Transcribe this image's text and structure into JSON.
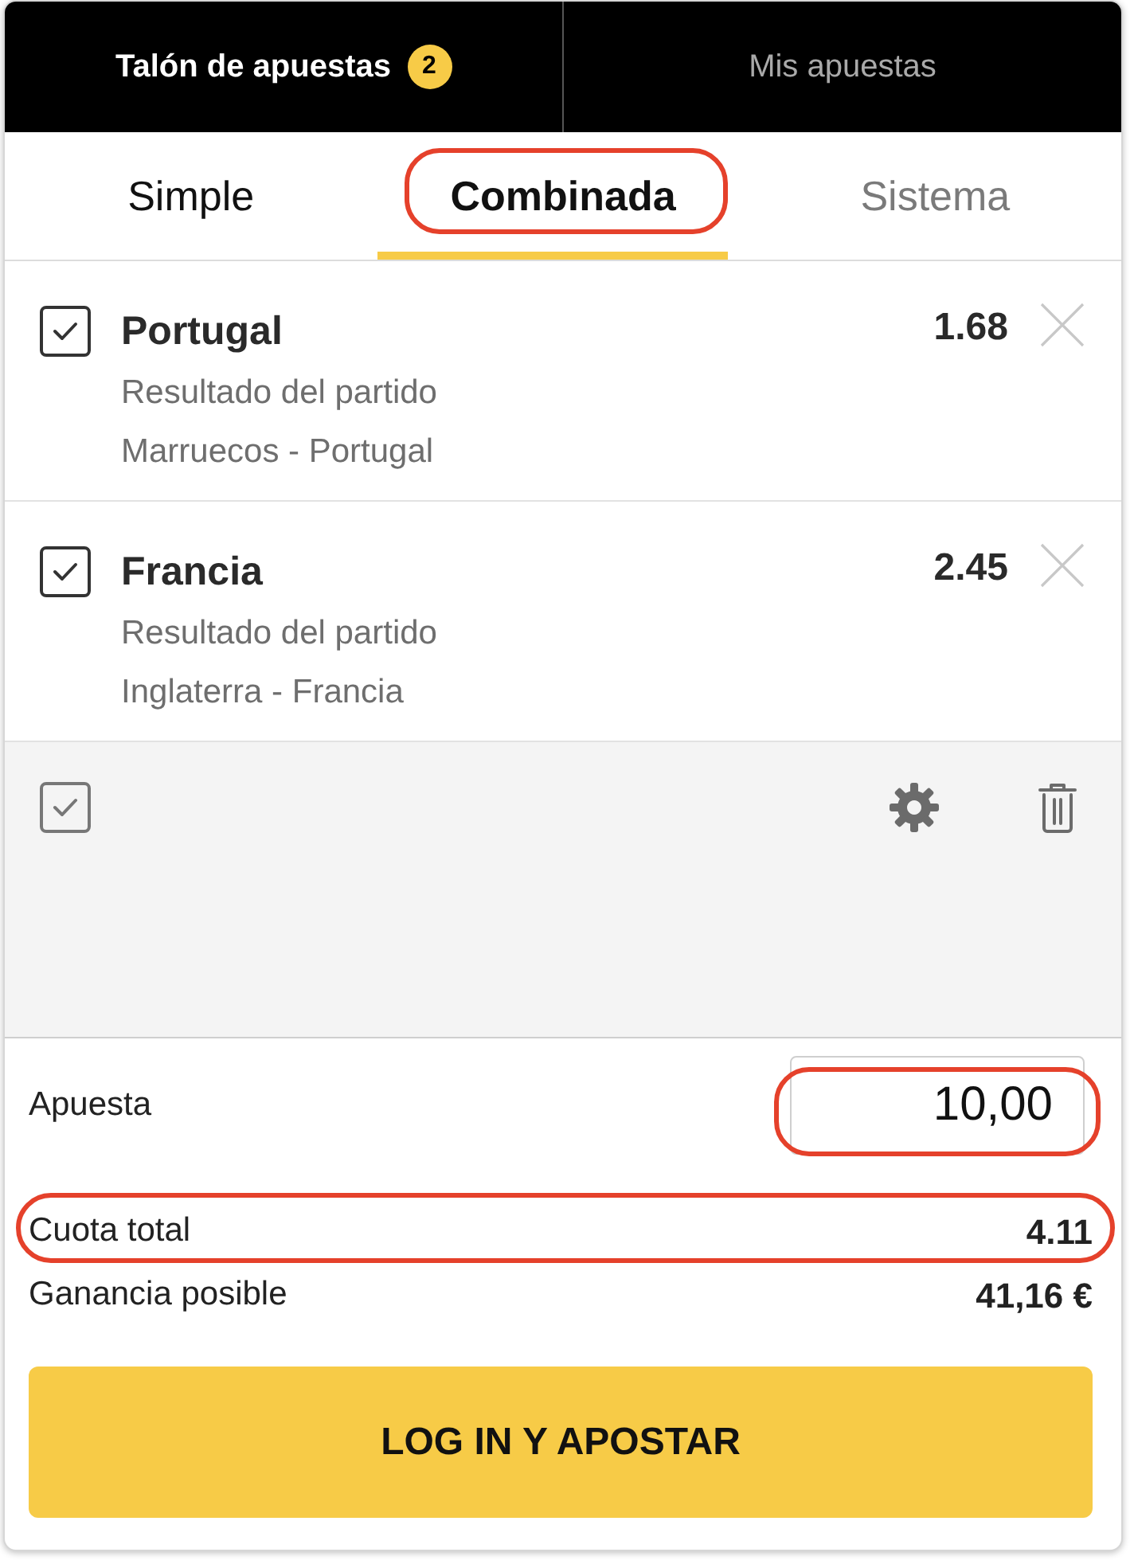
{
  "header_tabs": [
    {
      "label": "Talón de apuestas",
      "badge": "2",
      "selected": true
    },
    {
      "label": "Mis apuestas",
      "selected": false
    }
  ],
  "bet_type_tabs": [
    {
      "label": "Simple",
      "selected": false,
      "disabled": false,
      "highlighted": false
    },
    {
      "label": "Combinada",
      "selected": true,
      "disabled": false,
      "highlighted": true
    },
    {
      "label": "Sistema",
      "selected": false,
      "disabled": true,
      "highlighted": false
    }
  ],
  "selections": [
    {
      "name": "Portugal",
      "market": "Resultado del partido",
      "event": "Marruecos - Portugal",
      "odds": "1.68",
      "checked": true
    },
    {
      "name": "Francia",
      "market": "Resultado del partido",
      "event": "Inglaterra - Francia",
      "odds": "2.45",
      "checked": true
    }
  ],
  "combo_panel": {
    "checked": true
  },
  "stake": {
    "label": "Apuesta",
    "value": "10,00",
    "highlighted": true
  },
  "summary": [
    {
      "label": "Cuota total",
      "value": "4.11",
      "highlighted": true
    },
    {
      "label": "Ganancia posible",
      "value": "41,16 €",
      "highlighted": false
    }
  ],
  "submit_button": "LOG IN Y APOSTAR"
}
